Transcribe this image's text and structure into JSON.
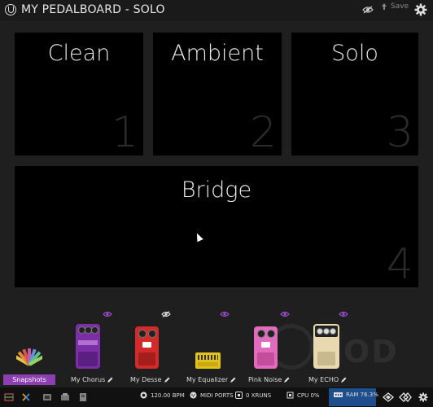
{
  "header": {
    "title": "MY PEDALBOARD - SOLO",
    "save_label": "Save"
  },
  "snapshots": [
    {
      "name": "Clean",
      "number": "1"
    },
    {
      "name": "Ambient",
      "number": "2"
    },
    {
      "name": "Solo",
      "number": "3"
    },
    {
      "name": "Bridge",
      "number": "4"
    }
  ],
  "tray": {
    "snapshots_button": "Snapshots",
    "watermark": "MOD",
    "pedals": [
      {
        "name": "My Chorus",
        "color": "#7a2fa6"
      },
      {
        "name": "My Desse",
        "color": "#d12b2b"
      },
      {
        "name": "My Equalizer",
        "color": "#e0c21a"
      },
      {
        "name": "Pink Noise",
        "color": "#e26bbd"
      },
      {
        "name": "My ECHO",
        "color": "#e9d9b0"
      }
    ]
  },
  "statusbar": {
    "bpm": "120.00 BPM",
    "midi": "MIDI PORTS",
    "xruns": "0 XRUNS",
    "cpu": "CPU 0%",
    "ram": "RAM 76.3%"
  },
  "colors": {
    "accent_purple": "#8c3fb0",
    "ram_blue": "#1e4f8c",
    "panel_bg": "#000000",
    "page_bg": "#1f1f1f"
  }
}
